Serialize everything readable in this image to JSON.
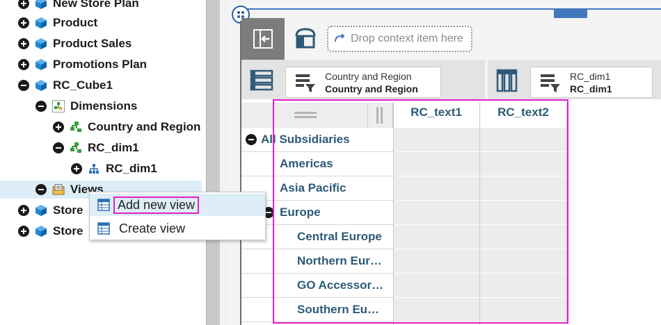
{
  "tree": {
    "items": [
      {
        "label": "New Store Plan",
        "expander": "plus",
        "icon": "cube-icon",
        "depth": 0
      },
      {
        "label": "Product",
        "expander": "plus",
        "icon": "cube-icon",
        "depth": 0
      },
      {
        "label": "Product Sales",
        "expander": "plus",
        "icon": "cube-icon",
        "depth": 0
      },
      {
        "label": "Promotions Plan",
        "expander": "plus",
        "icon": "cube-icon",
        "depth": 0
      },
      {
        "label": "RC_Cube1",
        "expander": "minus",
        "icon": "cube-icon",
        "depth": 0
      },
      {
        "label": "Dimensions",
        "expander": "minus",
        "icon": "dimensions-folder-icon",
        "depth": 1
      },
      {
        "label": "Country and Region",
        "expander": "plus",
        "icon": "dimension-icon",
        "depth": 2
      },
      {
        "label": "RC_dim1",
        "expander": "minus",
        "icon": "dimension-icon",
        "depth": 2
      },
      {
        "label": "RC_dim1",
        "expander": "plus",
        "icon": "hierarchy-icon",
        "depth": 3
      },
      {
        "label": "Views",
        "expander": "minus",
        "icon": "views-folder-icon",
        "depth": 1
      },
      {
        "label": "Store",
        "expander": "plus",
        "icon": "cube-icon",
        "depth": 0
      },
      {
        "label": "Store",
        "expander": "plus",
        "icon": "cube-icon",
        "depth": 0
      }
    ]
  },
  "context_menu": {
    "items": [
      {
        "label": "Add new view",
        "icon": "view-icon"
      },
      {
        "label": "Create view",
        "icon": "view-icon"
      }
    ]
  },
  "context_bar": {
    "drop_placeholder": "Drop context item here"
  },
  "rows_edge": {
    "line1": "Country and Region",
    "line2": "Country and Region"
  },
  "columns_edge": {
    "line1": "RC_dim1",
    "line2": "RC_dim1"
  },
  "crosstab": {
    "columns": [
      "RC_text1",
      "RC_text2"
    ],
    "rows": [
      {
        "label": "All Subsidiaries",
        "level": 0,
        "expander": "minus"
      },
      {
        "label": "Americas",
        "level": 1,
        "expander": ""
      },
      {
        "label": "Asia Pacific",
        "level": 1,
        "expander": ""
      },
      {
        "label": "Europe",
        "level": 1,
        "expander": "minus"
      },
      {
        "label": "Central Europe",
        "level": 2,
        "expander": ""
      },
      {
        "label": "Northern Eur…",
        "level": 2,
        "expander": ""
      },
      {
        "label": "GO Accessor…",
        "level": 2,
        "expander": ""
      },
      {
        "label": "Southern Eu…",
        "level": 2,
        "expander": ""
      }
    ]
  },
  "colors": {
    "accent_blue": "#4178be",
    "highlight_magenta": "#e020c8",
    "member_text": "#2d5a78",
    "cube_blue": "#1e88d2",
    "dim_green": "#3a9b3a"
  }
}
